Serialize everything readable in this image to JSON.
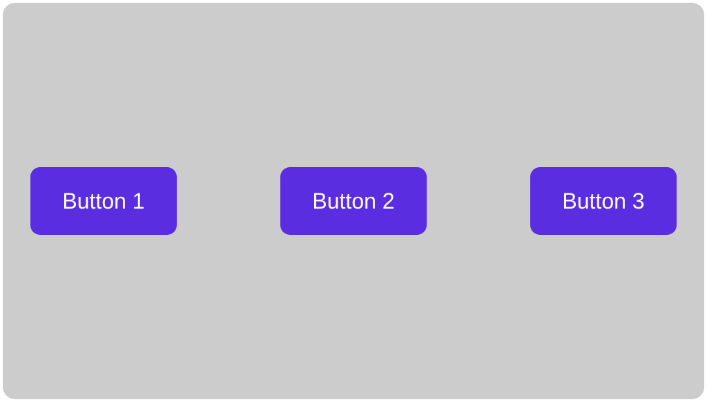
{
  "buttons": [
    {
      "label": "Button 1"
    },
    {
      "label": "Button 2"
    },
    {
      "label": "Button 3"
    }
  ],
  "colors": {
    "panel_bg": "#cccccc",
    "button_bg": "#5a2de0",
    "button_fg": "#ffffff"
  }
}
